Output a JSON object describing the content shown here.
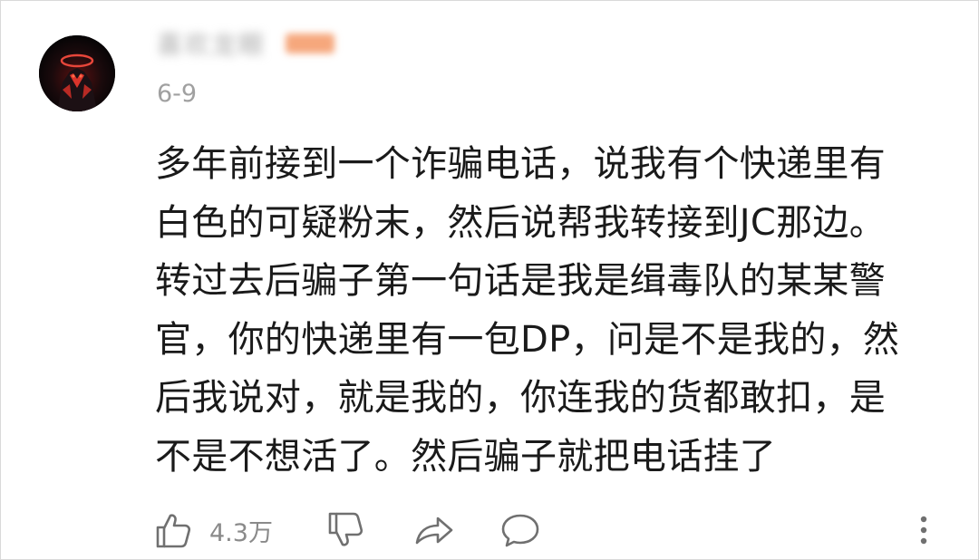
{
  "comment": {
    "username": "喜欢龙眼",
    "date": "6-9",
    "lines": [
      "多年前接到一个诈骗电话，说我有个快递里有",
      "白色的可疑粉末，然后说帮我转接到JC那边。",
      "转过去后骗子第一句话是我是缉毒队的某某警",
      "官，你的快递里有一包DP，问是不是我的，然",
      "后我说对，就是我的，你连我的货都敢扣，是",
      "不是不想活了。然后骗子就把电话挂了"
    ]
  },
  "actions": {
    "like_count": "4.3万",
    "icons": [
      "thumbs-up-icon",
      "thumbs-down-icon",
      "share-icon",
      "comment-icon",
      "more-icon"
    ]
  },
  "colors": {
    "text": "#1a1a1a",
    "meta": "#a0a0a0",
    "icon": "#707070",
    "badge": "#f6a77c"
  }
}
